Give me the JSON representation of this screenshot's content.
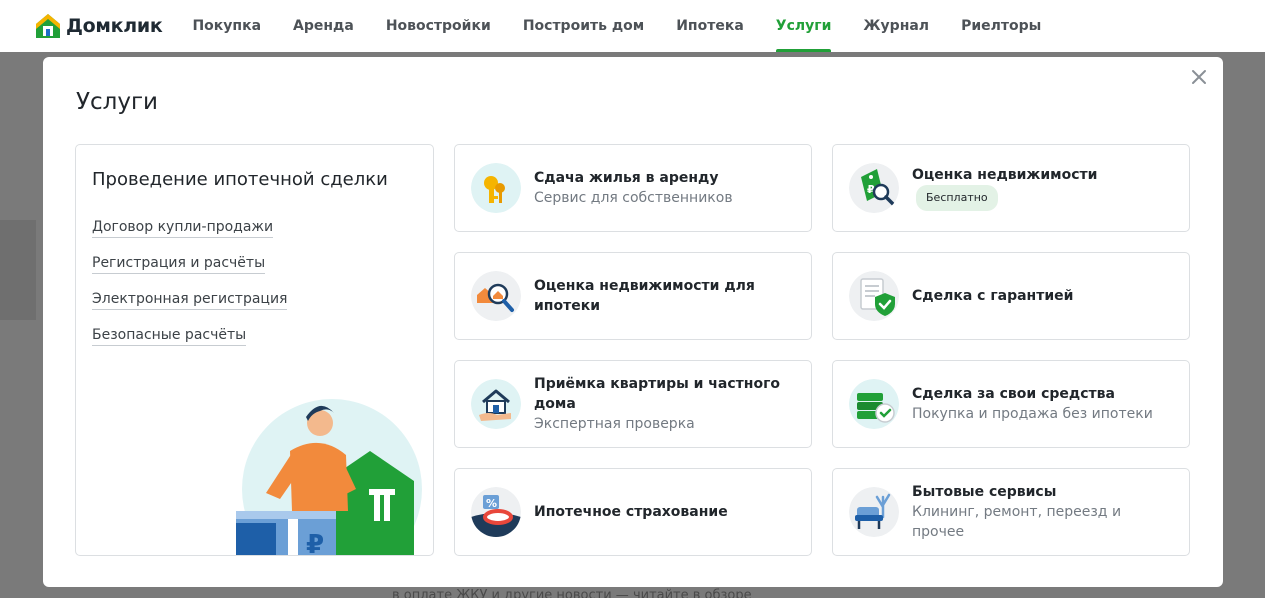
{
  "brand": {
    "name": "Домклик"
  },
  "nav": {
    "items": [
      {
        "label": "Покупка"
      },
      {
        "label": "Аренда"
      },
      {
        "label": "Новостройки"
      },
      {
        "label": "Построить дом"
      },
      {
        "label": "Ипотека"
      },
      {
        "label": "Услуги"
      },
      {
        "label": "Журнал"
      },
      {
        "label": "Риелторы"
      }
    ],
    "active": "Услуги"
  },
  "background": {
    "peek_text": "в оплате ЖКУ и другие новости — читайте в обзоре"
  },
  "modal": {
    "title": "Услуги",
    "close_icon": "close-icon",
    "left_panel": {
      "title": "Проведение ипотечной сделки",
      "links": [
        {
          "label": "Договор купли-продажи"
        },
        {
          "label": "Регистрация и расчёты"
        },
        {
          "label": "Электронная регистрация"
        },
        {
          "label": "Безопасные расчёты"
        }
      ],
      "illustration": "man-leaning-on-house-illustration"
    },
    "cards": [
      {
        "title": "Сдача жилья в аренду",
        "subtitle": "Сервис для собственников",
        "icon": "keys-icon"
      },
      {
        "title": "Оценка недвижимости",
        "badge": "Бесплатно",
        "icon": "price-tag-magnifier-icon"
      },
      {
        "title": "Оценка недвижимости для ипотеки",
        "icon": "house-magnifier-icon"
      },
      {
        "title": "Сделка с гарантией",
        "icon": "document-shield-icon"
      },
      {
        "title": "Приёмка квартиры и частного дома",
        "subtitle": "Экспертная проверка",
        "icon": "house-hand-icon"
      },
      {
        "title": "Сделка за свои средства",
        "subtitle": "Покупка и продажа без ипотеки",
        "icon": "money-check-icon"
      },
      {
        "title": "Ипотечное страхование",
        "icon": "percent-lifebuoy-icon"
      },
      {
        "title": "Бытовые сервисы",
        "subtitle": "Клининг, ремонт, переезд и прочее",
        "icon": "armchair-plant-icon"
      }
    ],
    "colors": {
      "accent": "#21a038",
      "badge_bg": "#e3f2e6"
    }
  }
}
